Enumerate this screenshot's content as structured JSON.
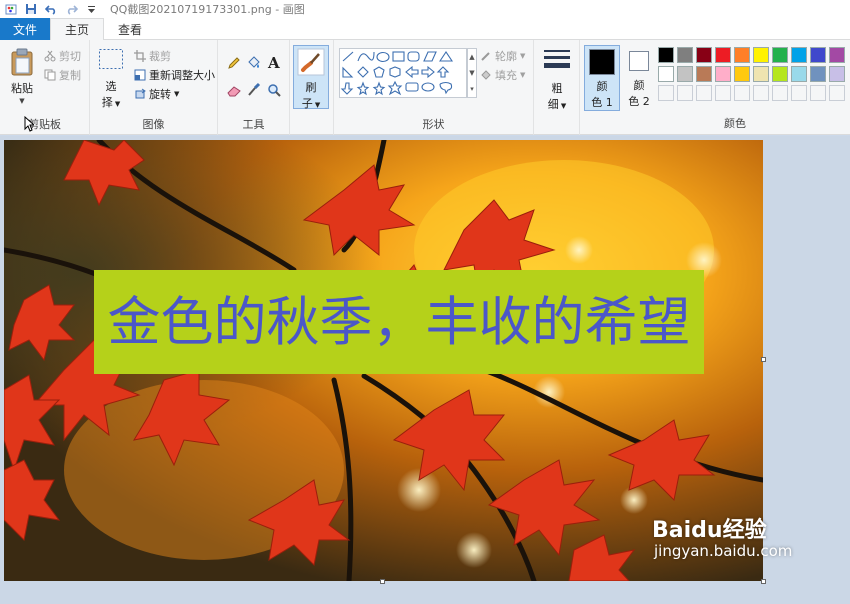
{
  "window": {
    "title": "QQ截图20210719173301.png - 画图"
  },
  "tabs": {
    "file": "文件",
    "home": "主页",
    "view": "查看"
  },
  "clipboard": {
    "paste": "粘贴",
    "cut": "剪切",
    "copy": "复制",
    "label": "剪贴板"
  },
  "image": {
    "select_top": "选",
    "select_bottom": "择",
    "crop": "裁剪",
    "resize": "重新调整大小",
    "rotate": "旋转",
    "label": "图像"
  },
  "tools": {
    "label": "工具"
  },
  "brushes": {
    "top": "刷",
    "bottom": "子"
  },
  "shapes": {
    "outline": "轮廓",
    "fill": "填充",
    "label": "形状"
  },
  "size": {
    "top": "粗",
    "bottom": "细"
  },
  "color1": {
    "top": "颜",
    "bottom": "色 1",
    "value": "#000000"
  },
  "color2": {
    "top": "颜",
    "bottom": "色 2",
    "value": "#ffffff"
  },
  "colors": {
    "label": "颜色",
    "row1": [
      "#000000",
      "#7f7f7f",
      "#880015",
      "#ed1c24",
      "#ff7f27",
      "#fff200",
      "#22b14c",
      "#00a2e8",
      "#3f48cc",
      "#a349a4"
    ],
    "row2": [
      "#ffffff",
      "#c3c3c3",
      "#b97a57",
      "#ffaec9",
      "#ffc90e",
      "#efe4b0",
      "#b5e61d",
      "#99d9ea",
      "#7092be",
      "#c8bfe7"
    ]
  },
  "canvas": {
    "text": "金色的秋季，丰收的希望",
    "text_color": "#4b57c9",
    "text_bg": "#b5d11a"
  },
  "watermark": {
    "brand": "Baidu经验",
    "url": "jingyan.baidu.com"
  }
}
